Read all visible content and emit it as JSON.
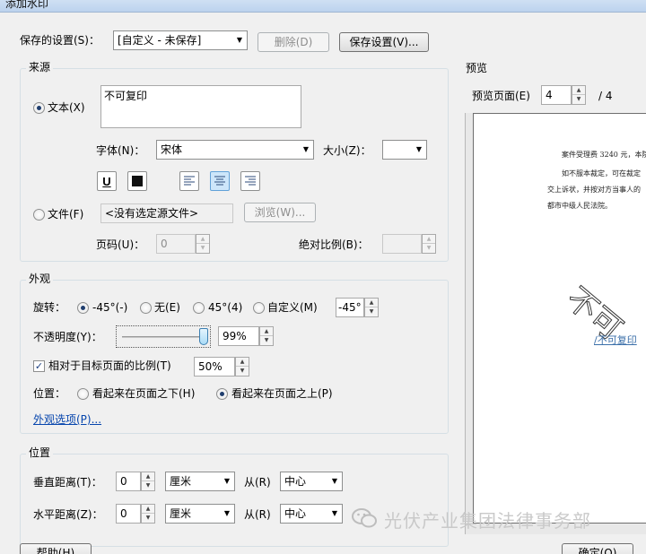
{
  "window": {
    "title": "添加水印"
  },
  "saved_settings": {
    "label": "保存的设置(S)：",
    "value": "[自定义 - 未保存]",
    "delete_label": "删除(D)",
    "save_label": "保存设置(V)..."
  },
  "source": {
    "title": "来源",
    "text_option": "文本(X)",
    "text_value": "不可复印",
    "font_label": "字体(N)：",
    "font_value": "宋体",
    "size_label": "大小(Z)：",
    "size_value": "",
    "file_option": "文件(F)",
    "file_placeholder": "<没有选定源文件>",
    "browse_label": "浏览(W)...",
    "page_label": "页码(U)：",
    "page_value": "0",
    "scale_label": "绝对比例(B)：",
    "scale_value": "",
    "selected": "text",
    "format_buttons": [
      "underline-icon",
      "color-swatch-icon",
      "align-left-icon",
      "align-center-icon",
      "align-right-icon"
    ],
    "active_align": "center"
  },
  "appearance": {
    "title": "外观",
    "rotation_label": "旋转：",
    "rotation_options": [
      "-45°(-)",
      "无(E)",
      "45°(4)",
      "自定义(M)"
    ],
    "rotation_selected": 0,
    "rotation_custom_value": "-45°",
    "opacity_label": "不透明度(Y)：",
    "opacity_value": "99%",
    "opacity_level": 0.99,
    "relative_scale_label": "相对于目标页面的比例(T)",
    "relative_scale_checked": true,
    "relative_scale_value": "50%",
    "position_label": "位置：",
    "position_options": [
      "看起来在页面之下(H)",
      "看起来在页面之上(P)"
    ],
    "position_selected": 1,
    "options_link": "外观选项(P)..."
  },
  "position": {
    "title": "位置",
    "vertical_label": "垂直距离(T)：",
    "vertical_value": "0",
    "vertical_unit": "厘米",
    "vertical_from_label": "从(R)",
    "vertical_from_value": "中心",
    "horizontal_label": "水平距离(Z)：",
    "horizontal_value": "0",
    "horizontal_unit": "厘米",
    "horizontal_from_label": "从(R)",
    "horizontal_from_value": "中心"
  },
  "preview": {
    "title": "预览",
    "page_label": "预览页面(E)",
    "page_value": "4",
    "page_total": "/ 4",
    "doc_lines": [
      "案件受理费 3240 元，本院",
      "如不服本裁定，可在裁定",
      "交上诉状，并按对方当事人的",
      "都市中级人民法院。"
    ],
    "doc_link": "/不可复印",
    "watermark_text": "不可"
  },
  "footer": {
    "help_label": "帮助(H)",
    "ok_label": "确定(O)",
    "brand_text": "光伏产业集团法律事务部",
    "brand_icon": "wechat-icon"
  },
  "colors": {
    "link": "#0645ad",
    "radio_dot": "#1f3e6e",
    "selected_button": "#cde6fa"
  }
}
